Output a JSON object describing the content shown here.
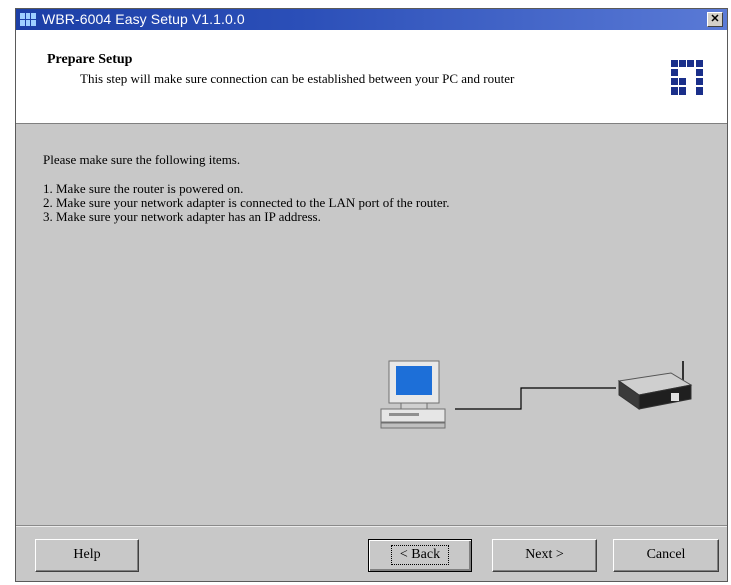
{
  "window": {
    "title": "WBR-6004 Easy Setup  V1.1.0.0",
    "close_label": "✕"
  },
  "header": {
    "title": "Prepare Setup",
    "subtitle": "This step will make sure connection can be established between your PC and router",
    "logo_icon": "levelone-logo-icon"
  },
  "content": {
    "intro": "Please make sure the following items.",
    "steps": [
      "1. Make sure the router is powered on.",
      "2. Make sure your network adapter is connected to the LAN port of the router.",
      "3. Make sure your network adapter has an IP address."
    ],
    "illustration_icons": [
      "computer-icon",
      "router-icon"
    ]
  },
  "buttons": {
    "help": "Help",
    "back": "< Back",
    "next": "Next >",
    "cancel": "Cancel"
  },
  "colors": {
    "titlebar": "#1c3fa6",
    "dialog_bg": "#c8c8c8",
    "header_bg": "#ffffff"
  }
}
